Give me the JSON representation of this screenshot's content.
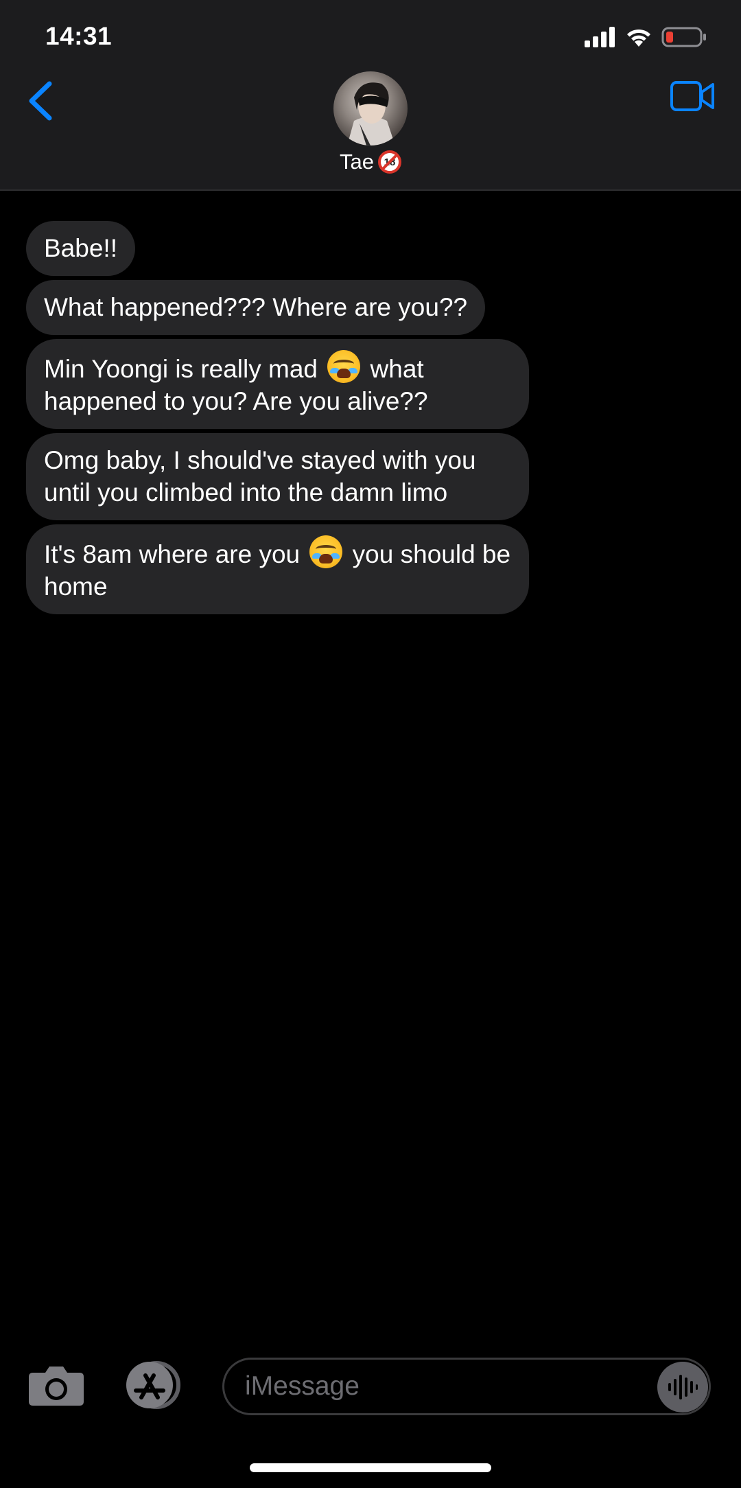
{
  "status_bar": {
    "time": "14:31",
    "icons": [
      "cellular-signal-icon",
      "wifi-icon",
      "battery-low-icon"
    ],
    "battery_color": "#eb4034"
  },
  "header": {
    "back_icon": "chevron-left-icon",
    "contact_name": "Tae",
    "contact_badge": "18",
    "video_icon": "video-camera-icon",
    "accent_color": "#0a84ff"
  },
  "messages": [
    {
      "text": "Babe!!"
    },
    {
      "text": "What happened??? Where are you??"
    },
    {
      "parts": [
        "Min Yoongi is really mad ",
        " what happened to you? Are you alive??"
      ],
      "emoji": "loudly-crying-face-emoji"
    },
    {
      "text": "Omg baby, I should've stayed with you until you climbed into the damn limo"
    },
    {
      "parts": [
        "It's 8am where are you ",
        " you should be home"
      ],
      "emoji": "loudly-crying-face-emoji"
    }
  ],
  "input_bar": {
    "camera_icon": "camera-icon",
    "apps_icon": "app-store-icon",
    "placeholder": "iMessage",
    "dictation_icon": "waveform-icon"
  }
}
